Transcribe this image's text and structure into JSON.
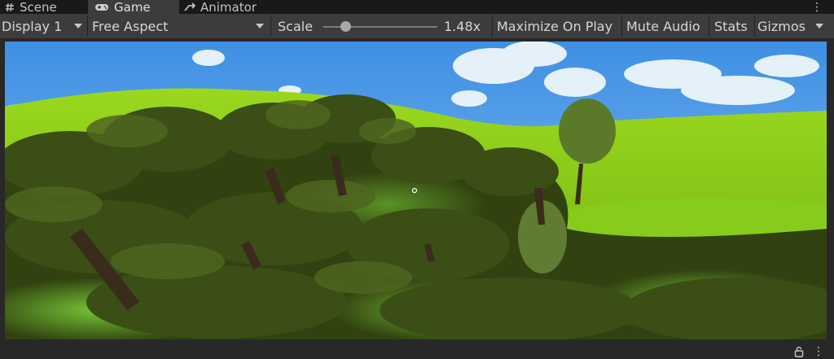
{
  "tabs": [
    {
      "label": "Scene",
      "icon": "hash-icon"
    },
    {
      "label": "Game",
      "icon": "gamepad-icon"
    },
    {
      "label": "Animator",
      "icon": "animator-icon"
    }
  ],
  "toolbar": {
    "display": "Display 1",
    "aspect": "Free Aspect",
    "scale_label": "Scale",
    "scale_value": "1.48x",
    "scale_fraction": 0.19,
    "maximize_on_play": "Maximize On Play",
    "mute_audio": "Mute Audio",
    "stats": "Stats",
    "gizmos": "Gizmos"
  },
  "colors": {
    "background": "#282828",
    "tabbar": "#191919",
    "toolbar": "#3c3c3c",
    "sky": "#5aa0e8",
    "hills": "#8fd11c",
    "foliage_dark": "#2f3f10"
  },
  "bottom_icons": [
    "lock-icon",
    "kebab-menu-icon"
  ]
}
